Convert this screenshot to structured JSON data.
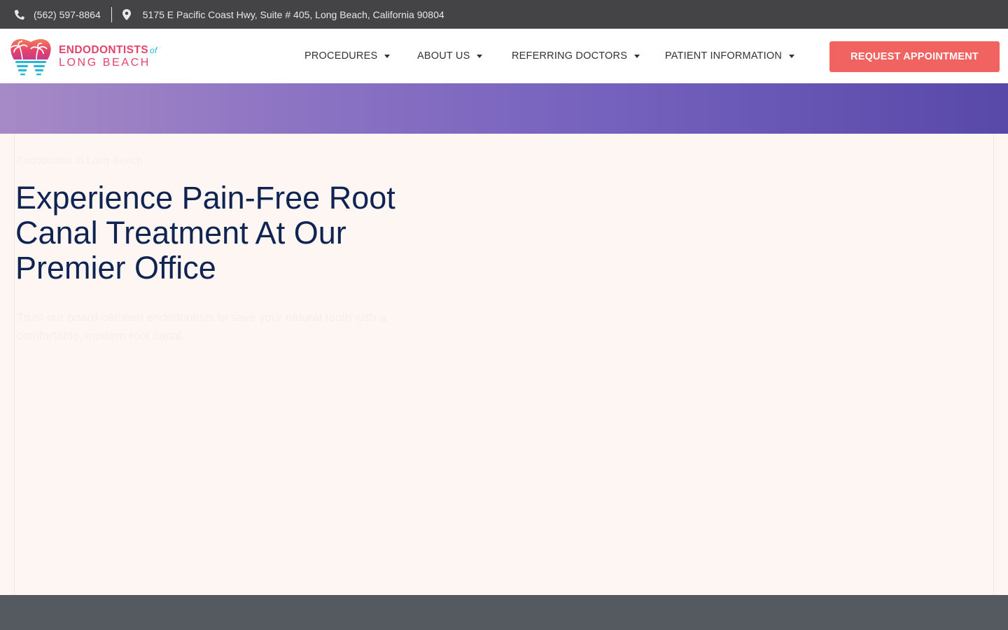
{
  "topbar": {
    "phone": "(562) 597-8864",
    "address": "5175 E Pacific Coast Hwy, Suite # 405, Long Beach, California 90804"
  },
  "logo": {
    "line1": "ENDODONTISTS",
    "of": "of",
    "line2": "LONG BEACH"
  },
  "nav": {
    "items": [
      {
        "label": "PROCEDURES"
      },
      {
        "label": "ABOUT US"
      },
      {
        "label": "REFERRING DOCTORS"
      },
      {
        "label": "PATIENT INFORMATION"
      }
    ],
    "cta_label": "REQUEST APPOINTMENT"
  },
  "hero": {
    "breadcrumb": "Endodontist in Long Beach",
    "title": "Experience Pain-Free Root Canal Treatment At Our Premier Office",
    "subtitle": "Trust our board-certified endodontists to save your natural tooth with a comfortable, modern root canal."
  },
  "colors": {
    "topbar_bg": "#444446",
    "brand_pink": "#e4446b",
    "cta_bg": "#f06361",
    "title_navy": "#0f2452",
    "hero_bg": "#fdf6f2",
    "footer_bg": "#555a61"
  },
  "icons": {
    "phone": "phone-icon",
    "location": "map-pin-icon",
    "caret": "caret-down-icon"
  }
}
